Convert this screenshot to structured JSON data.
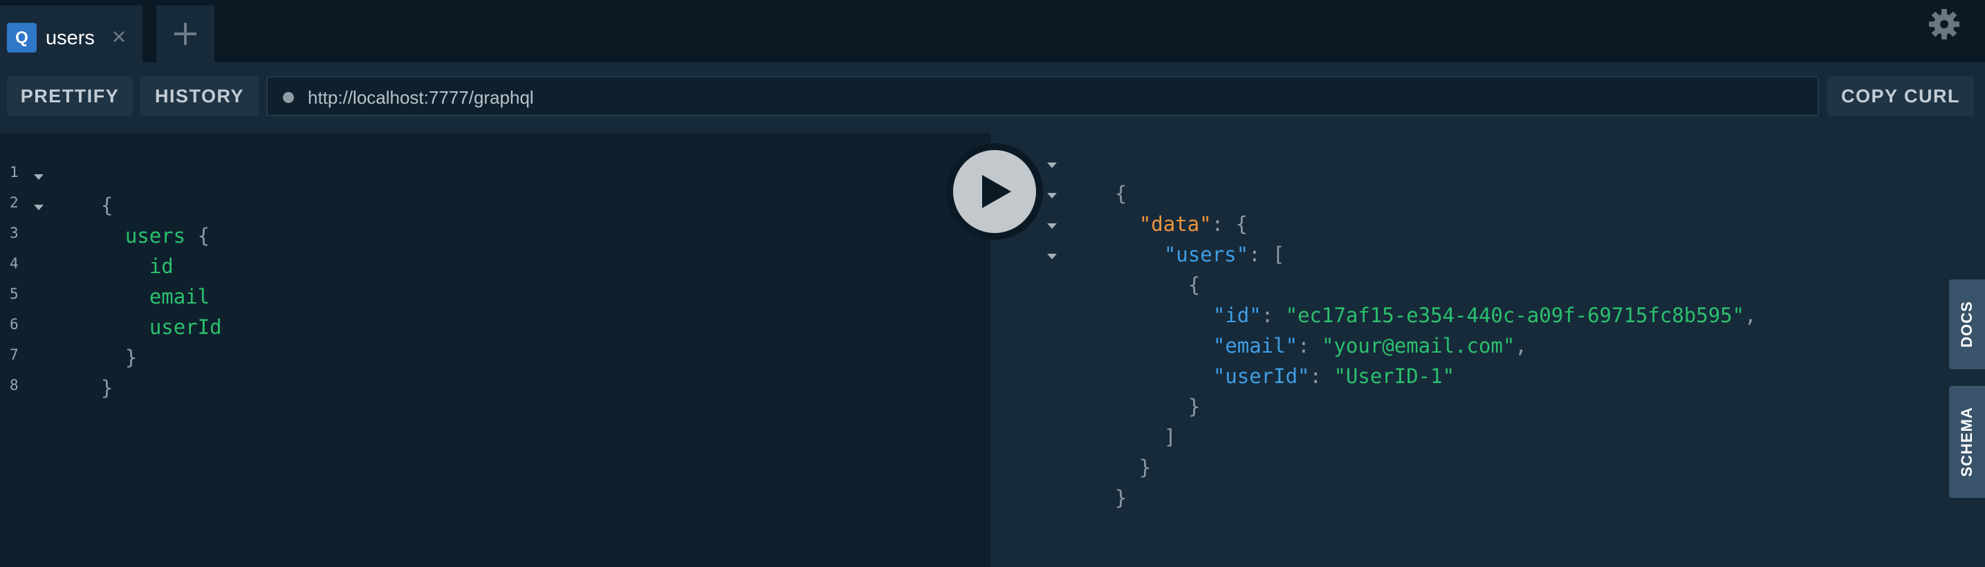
{
  "tab": {
    "badge": "Q",
    "title": "users"
  },
  "toolbar": {
    "prettify_label": "PRETTIFY",
    "history_label": "HISTORY",
    "endpoint": "http://localhost:7777/graphql",
    "copy_curl_label": "COPY CURL"
  },
  "query_editor": {
    "line_numbers": [
      "1",
      "2",
      "3",
      "4",
      "5",
      "6",
      "7",
      "8"
    ],
    "lines": {
      "l1_brace": "{",
      "l2_field": "users",
      "l2_brace": " {",
      "l3_field": "id",
      "l4_field": "email",
      "l5_field": "userId",
      "l6_brace": "}",
      "l7_brace": "}"
    }
  },
  "result": {
    "open_brace": "{",
    "data_key": "\"data\"",
    "colon_brace": ": {",
    "users_key": "\"users\"",
    "colon_bracket": ": [",
    "item_open": "{",
    "id_key": "\"id\"",
    "id_value": "\"ec17af15-e354-440c-a09f-69715fc8b595\"",
    "email_key": "\"email\"",
    "email_value": "\"your@email.com\"",
    "userId_key": "\"userId\"",
    "userId_value": "\"UserID-1\"",
    "colon_sep": ": ",
    "comma": ",",
    "item_close": "}",
    "array_close": "]",
    "data_close": "}",
    "root_close": "}"
  },
  "side_tabs": {
    "docs_label": "DOCS",
    "schema_label": "SCHEMA"
  },
  "colors": {
    "background": "#0f202d",
    "panel": "#172a3a",
    "field_green": "#2bc06d",
    "key_blue": "#3f9ee5",
    "data_key_orange": "#f0943c",
    "badge_blue": "#2f77c8"
  },
  "icons": [
    "close-icon",
    "plus-icon",
    "gear-icon",
    "play-icon",
    "status-dot-icon"
  ]
}
